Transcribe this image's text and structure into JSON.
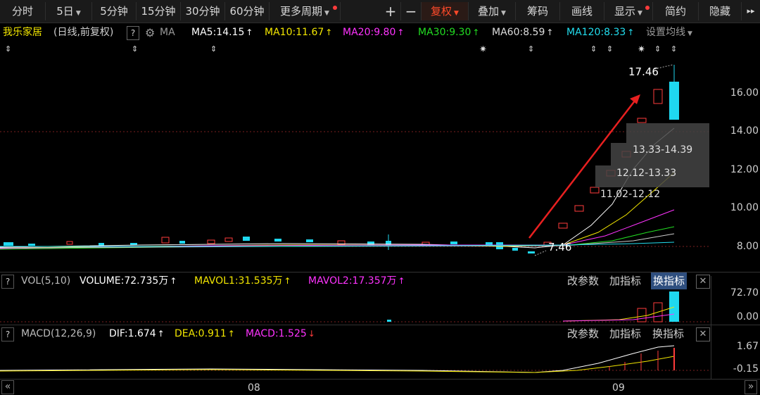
{
  "toolbar": {
    "tabs": [
      {
        "label": "分时"
      },
      {
        "label": "5日",
        "dropdown": true
      },
      {
        "label": "5分钟"
      },
      {
        "label": "15分钟"
      },
      {
        "label": "30分钟"
      },
      {
        "label": "60分钟"
      },
      {
        "label": "更多周期",
        "dot": true
      }
    ],
    "plus": "+",
    "minus": "−",
    "actions": [
      {
        "label": "复权",
        "dropdown": true,
        "active": true
      },
      {
        "label": "叠加",
        "dropdown": true
      },
      {
        "label": "筹码"
      },
      {
        "label": "画线"
      },
      {
        "label": "显示",
        "dropdown": true,
        "dot": true
      },
      {
        "label": "简约"
      },
      {
        "label": "隐藏"
      }
    ],
    "collapse_glyph": "▸▸"
  },
  "info": {
    "stock_name": "我乐家居",
    "period": "(日线,前复权)",
    "help": "?",
    "ma_label": "MA",
    "ma": [
      {
        "text": "MA5:14.15",
        "color": "#ffffff"
      },
      {
        "text": "MA10:11.67",
        "color": "#f2e600"
      },
      {
        "text": "MA20:9.80",
        "color": "#ff33ff"
      },
      {
        "text": "MA30:9.30",
        "color": "#22dd22"
      },
      {
        "text": "MA60:8.59",
        "color": "#dddddd"
      },
      {
        "text": "MA120:8.33",
        "color": "#22ddee"
      }
    ],
    "settings": "设置均线"
  },
  "y_axis": [
    "16.00",
    "14.00",
    "12.00",
    "10.00",
    "8.00"
  ],
  "annotations": {
    "high": "17.46",
    "low": "7.46",
    "chips": [
      "13.33-14.39",
      "12.12-13.33",
      "11.02-12.12"
    ]
  },
  "vol": {
    "name": "VOL(5,10)",
    "volume": "VOLUME:72.735万",
    "mavol1": "MAVOL1:31.535万",
    "mavol2": "MAVOL2:17.357万",
    "y_labels": [
      "72.70",
      "0.00"
    ]
  },
  "macd": {
    "name": "MACD(12,26,9)",
    "dif": "DIF:1.674",
    "dea": "DEA:0.911",
    "macd": "MACD:1.525",
    "y_labels": [
      "1.67",
      "-0.15"
    ]
  },
  "panel_buttons": {
    "params": "改参数",
    "add": "加指标",
    "switch": "换指标",
    "close": "✕"
  },
  "x_axis": [
    "08",
    "09"
  ],
  "scroll_left": "«",
  "scroll_right": "»",
  "colors": {
    "up": "#ff3b3b",
    "down": "#1fd8f0",
    "accent": "#ff4a2a"
  }
}
